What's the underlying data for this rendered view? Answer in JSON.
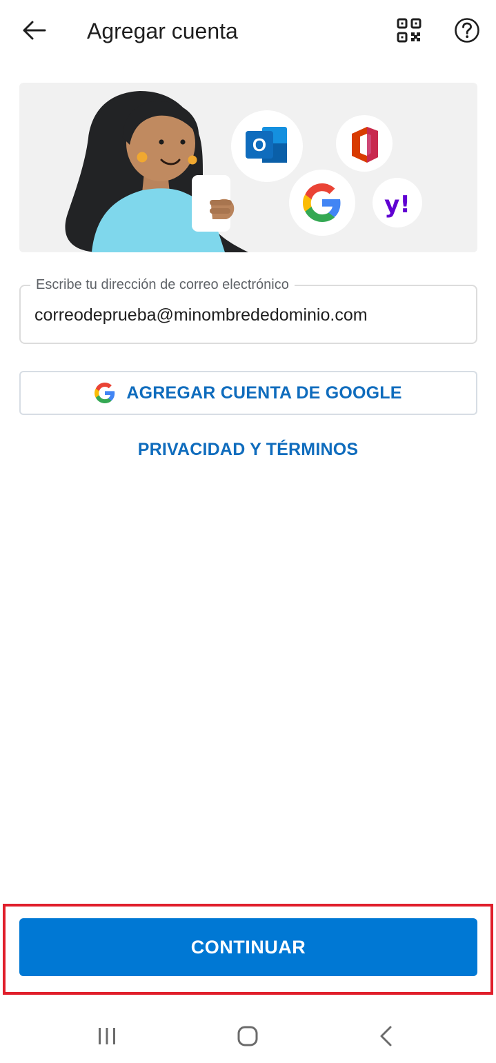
{
  "header": {
    "title": "Agregar cuenta"
  },
  "icons": {
    "back": "arrow-left-icon",
    "qr": "qr-code-icon",
    "help": "question-circle-icon"
  },
  "hero": {
    "providers": [
      "outlook",
      "office",
      "google",
      "yahoo"
    ],
    "yahoo_text": "y!",
    "outlook_text": "O"
  },
  "email": {
    "label": "Escribe tu dirección de correo electrónico",
    "value": "correodeprueba@minombrededominio.com"
  },
  "google_button": {
    "label": "AGREGAR CUENTA DE GOOGLE"
  },
  "privacy_link": {
    "label": "PRIVACIDAD Y TÉRMINOS"
  },
  "continue_button": {
    "label": "CONTINUAR"
  },
  "colors": {
    "accent": "#0078d4",
    "link": "#0f6cbd",
    "highlight": "#e01e2b",
    "hero_bg": "#f1f1f1"
  }
}
